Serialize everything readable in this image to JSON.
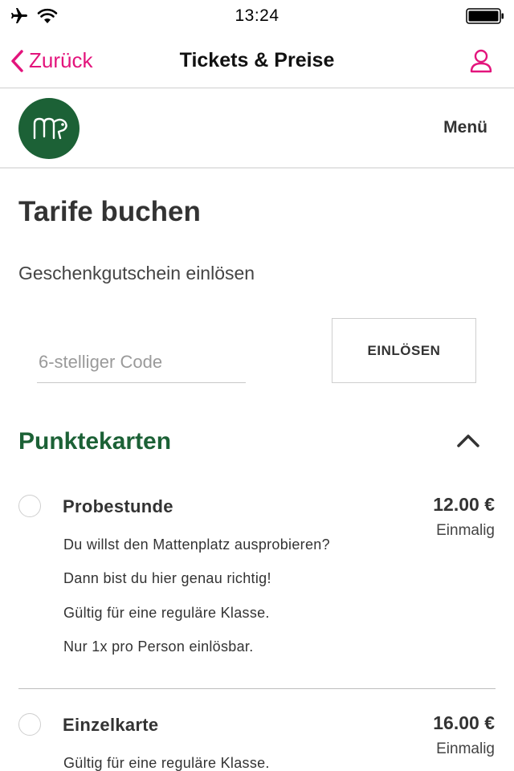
{
  "status_bar": {
    "time": "13:24",
    "icons": [
      "airplane-icon",
      "wifi-icon",
      "battery-icon"
    ]
  },
  "nav": {
    "back_label": "Zurück",
    "title": "Tickets & Preise",
    "accent_color": "#e3147c"
  },
  "header": {
    "menu_label": "Menü",
    "logo_color": "#1c6136"
  },
  "main": {
    "title": "Tarife buchen",
    "voucher_label": "Geschenkgutschein einlösen",
    "code_placeholder": "6-stelliger Code",
    "code_value": "",
    "redeem_label": "EINLÖSEN"
  },
  "section": {
    "title": "Punktekarten",
    "expanded": true,
    "color": "#1c6136",
    "offers": [
      {
        "name": "Probestunde",
        "price": "12.00 €",
        "frequency": "Einmalig",
        "selected": false,
        "description": [
          "Du willst den Mattenplatz ausprobieren?",
          "Dann bist du hier genau richtig!",
          "Gültig für eine reguläre Klasse.",
          "Nur 1x pro Person einlösbar."
        ]
      },
      {
        "name": "Einzelkarte",
        "price": "16.00 €",
        "frequency": "Einmalig",
        "selected": false,
        "description": [
          "Gültig für eine reguläre Klasse."
        ]
      }
    ]
  }
}
